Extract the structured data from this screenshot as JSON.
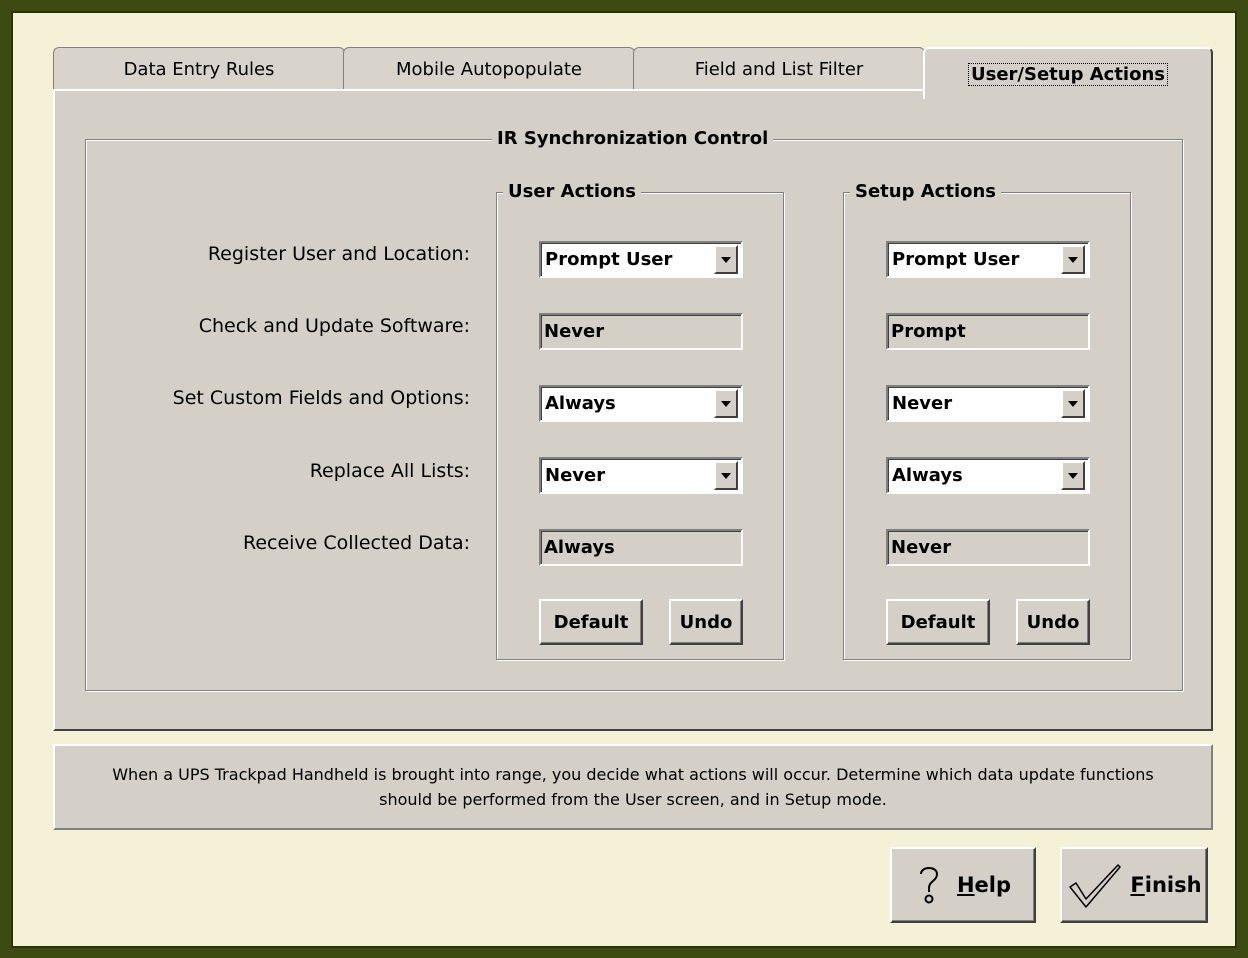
{
  "tabs": [
    {
      "label": "Data Entry Rules"
    },
    {
      "label": "Mobile Autopopulate"
    },
    {
      "label": "Field and List Filter"
    },
    {
      "label": "User/Setup Actions"
    }
  ],
  "sync": {
    "title": "IR Synchronization Control",
    "rows": [
      {
        "label": "Register User and Location:"
      },
      {
        "label": "Check and Update Software:"
      },
      {
        "label": "Set Custom Fields and Options:"
      },
      {
        "label": "Replace All Lists:"
      },
      {
        "label": "Receive Collected Data:"
      }
    ],
    "user": {
      "title": "User Actions",
      "values": [
        "Prompt User",
        "Never",
        "Always",
        "Never",
        "Always"
      ],
      "default_label": "Default",
      "undo_label": "Undo"
    },
    "setup": {
      "title": "Setup Actions",
      "values": [
        "Prompt User",
        "Prompt",
        "Never",
        "Always",
        "Never"
      ],
      "default_label": "Default",
      "undo_label": "Undo"
    }
  },
  "info_text_line1": "When a UPS Trackpad Handheld is brought into range, you decide what actions will occur.  Determine which data update functions",
  "info_text_line2": "should be performed from the User screen, and in Setup mode.",
  "help": {
    "mnemonic": "H",
    "rest": "elp"
  },
  "finish": {
    "mnemonic": "F",
    "rest": "inish"
  }
}
